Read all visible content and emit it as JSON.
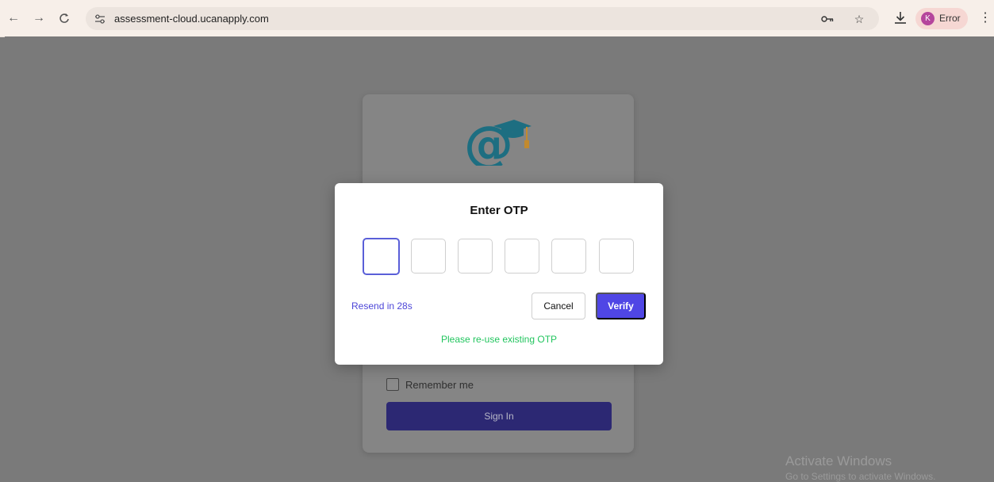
{
  "browser": {
    "url": "assessment-cloud.ucanapply.com",
    "profile_initial": "K",
    "profile_label": "Error"
  },
  "card": {
    "remember_label": "Remember me",
    "signin_label": "Sign In"
  },
  "modal": {
    "title": "Enter OTP",
    "otp_digits": [
      "",
      "",
      "",
      "",
      "",
      ""
    ],
    "resend_text": "Resend in 28s",
    "cancel_label": "Cancel",
    "verify_label": "Verify",
    "message": "Please re-use existing OTP"
  },
  "watermark": {
    "title": "Activate Windows",
    "subtitle": "Go to Settings to activate Windows."
  },
  "icons": {
    "back": "arrow-left-icon",
    "forward": "arrow-right-icon",
    "reload": "reload-icon",
    "site_settings": "tune-icon",
    "password_key": "key-icon",
    "bookmark": "star-icon",
    "download": "download-icon",
    "menu": "kebab-menu-icon",
    "logo": "at-graduation-cap-logo"
  },
  "colors": {
    "accent": "#4f46e5",
    "success": "#22c55e",
    "overlay": "#7a7a7a"
  }
}
